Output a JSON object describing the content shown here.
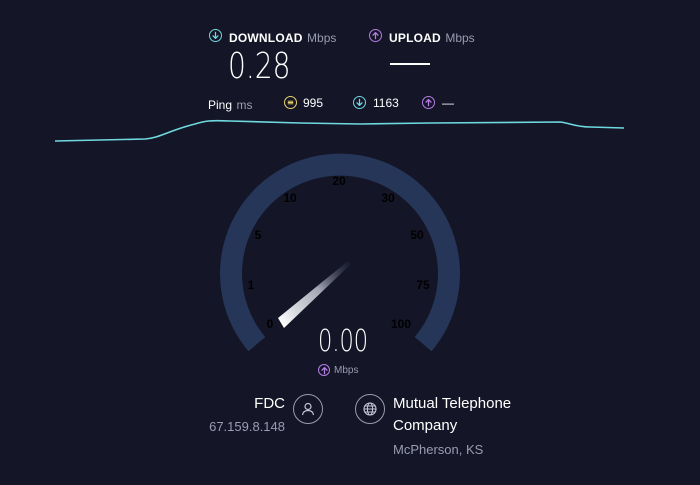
{
  "header": {
    "download": {
      "label": "DOWNLOAD",
      "unit": "Mbps",
      "value": "0.28",
      "icon": "arrow-down-circle-icon"
    },
    "upload": {
      "label": "UPLOAD",
      "unit": "Mbps",
      "value": "—",
      "icon": "arrow-up-circle-icon"
    }
  },
  "ping": {
    "label": "Ping",
    "unit": "ms",
    "jitter_value": "995",
    "download_value": "1163",
    "upload_value": "—"
  },
  "gauge": {
    "ticks": [
      "0",
      "1",
      "5",
      "10",
      "20",
      "30",
      "50",
      "75",
      "100"
    ],
    "value": "0.00",
    "unit": "Mbps"
  },
  "server": {
    "host": "FDC",
    "ip": "67.159.8.148",
    "isp": "Mutual Telephone",
    "isp_line2": "Company",
    "location": "McPherson, KS"
  },
  "colors": {
    "background": "#141526",
    "download": "#6fd9e0",
    "upload": "#b47ee5",
    "jitter": "#e8d36a",
    "gauge_track": "#263659"
  }
}
